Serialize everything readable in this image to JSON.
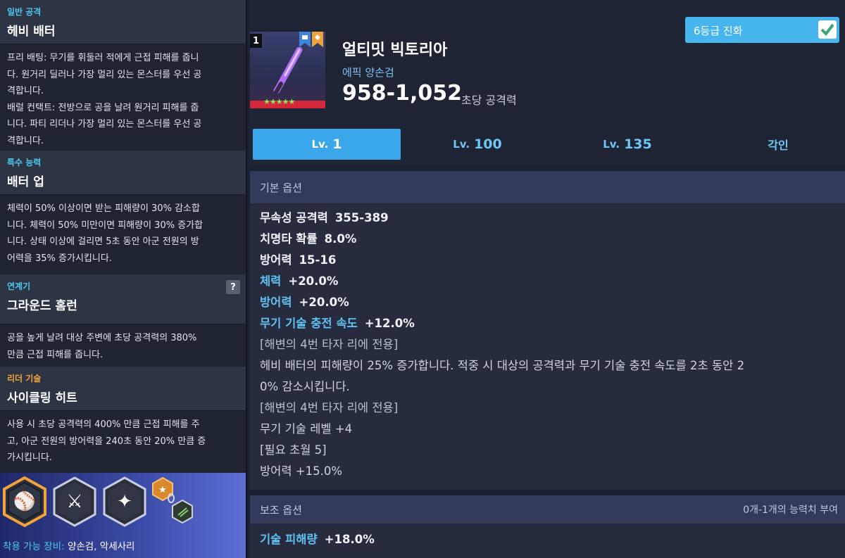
{
  "left": {
    "sections": [
      {
        "tag": "일반 공격",
        "title": "헤비 배터",
        "lines": [
          "프리 배팅: 무기를 휘둘러 적에게 근접 피해를 줍니",
          "다. 원거리 딜러나 가장 멀리 있는 몬스터를 우선 공",
          "격합니다.",
          "배럴 컨택트: 전방으로 공을 날려 원거리 피해를 줍",
          "니다. 파티 리더나 가장 멀리 있는 몬스터를 우선 공",
          "격합니다."
        ]
      },
      {
        "tag": "특수 능력",
        "title": "배터 업",
        "lines": [
          "체력이 50% 이상이면 받는 피해량이 30% 감소합",
          "니다. 체력이 50% 미만이면 피해량이 30% 증가합",
          "니다. 상태 이상에 걸리면 5초 동안 아군 전원의 방",
          "어력을 35% 증가시킵니다."
        ]
      },
      {
        "tag": "연계기",
        "title": "그라운드 홈런",
        "help": "?",
        "lines": [
          "공을 높게 날려 대상 주변에 초당 공격력의 380%",
          "만큼 근접 피해를 줍니다."
        ]
      },
      {
        "tag": "리더 기술",
        "title": "사이클링 히트",
        "lines": [
          "사용 시 초당 공격력의 400% 만큼 근접 피해를 주",
          "고, 아군 전원의 방어력을 240초 동안 20% 만큼 증",
          "가시킵니다."
        ]
      }
    ],
    "equip_label": "착용 가능 장비:",
    "equip_value": "양손검, 악세사리",
    "skill_icons": [
      "bat-skill-icon",
      "sword-skill-icon",
      "sparkle-skill-icon",
      "star-rank-badge-icon",
      "link-badge-icon"
    ]
  },
  "weapon": {
    "level": "1",
    "name": "얼티밋 빅토리아",
    "type": "에픽 양손검",
    "attack": "958-1,052",
    "attack_label": "초당 공격력",
    "stars": "★★★★★",
    "evolve_label": "6등급 진화",
    "evolve_checked": true
  },
  "tabs": [
    {
      "prefix": "Lv.",
      "value": "1",
      "active": true
    },
    {
      "prefix": "Lv.",
      "value": "100",
      "active": false
    },
    {
      "prefix": "Lv.",
      "value": "135",
      "active": false
    },
    {
      "prefix": "",
      "value": "각인",
      "active": false
    }
  ],
  "basic": {
    "title": "기본 옵션",
    "stats": [
      {
        "name": "무속성 공격력",
        "value": "355-389",
        "style": "white"
      },
      {
        "name": "치명타 확률",
        "value": "8.0%",
        "style": "white"
      },
      {
        "name": "방어력",
        "value": "15-16",
        "style": "white"
      },
      {
        "name": "체력",
        "value": "+20.0%",
        "style": "blue"
      },
      {
        "name": "방어력",
        "value": "+20.0%",
        "style": "blue"
      },
      {
        "name": "무기 기술 충전 속도",
        "value": "+12.0%",
        "style": "blue"
      }
    ],
    "extra": [
      {
        "text": "[해변의 4번 타자 리에 전용]",
        "style": "plain"
      },
      {
        "text": "헤비 배터의 피해량이 25% 증가합니다. 적중 시 대상의 공격력과 무기 기술 충전 속도를 2초 동안 2",
        "style": "desc"
      },
      {
        "text": "0% 감소시킵니다.",
        "style": "desc"
      },
      {
        "text": "[해변의 4번 타자 리에 전용]",
        "style": "plain"
      },
      {
        "text": "무기 기술 레벨 +4",
        "style": "desc"
      },
      {
        "text": "[필요 초월 5]",
        "style": "desc"
      },
      {
        "text": "방어력 +15.0%",
        "style": "desc"
      }
    ]
  },
  "sub": {
    "title": "보조 옵션",
    "note": "0개-1개의 능력치 부여",
    "stats": [
      {
        "name": "기술 피해량",
        "value": "+18.0%"
      }
    ]
  },
  "colors": {
    "accent": "#39a7ea",
    "cyan": "#4ec7ef",
    "orange": "#f2a33a",
    "red": "#d3283a",
    "green_star": "#8be95a"
  }
}
